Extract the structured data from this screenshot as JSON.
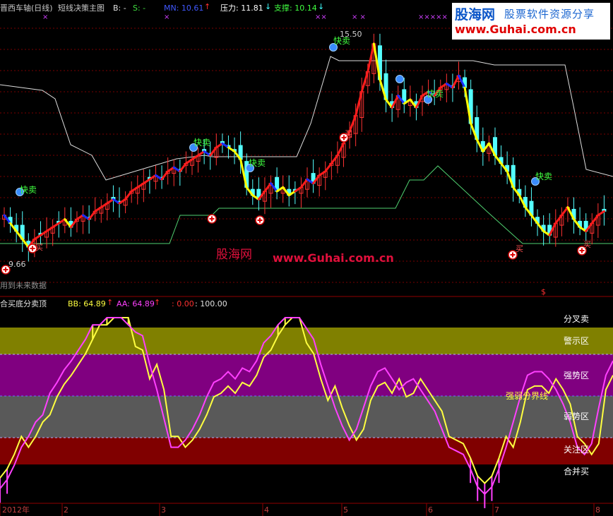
{
  "upper_panel": {
    "stock_name": "晋西车轴(日线)",
    "indicator_name": "短线决策主图",
    "b_label": "B: -",
    "s_label": "S: -",
    "mn_label": "MN: 10.61",
    "mn_arrow": "↑",
    "pressure_label": "压力: 11.81",
    "pressure_arrow": "↓",
    "support_label": "支撑: 10.14",
    "support_arrow": "↓",
    "high_price_label": "15.50",
    "low_price_label": "9.66",
    "future_data_note": "用到未来数据",
    "dollar_mark": "$",
    "fast_sell_label": "快卖",
    "buy_label": "买",
    "cross_marks": [
      "×",
      "×",
      "××",
      "× ×",
      "×××××",
      "×"
    ]
  },
  "lower_panel": {
    "indicator_name": "合买底分卖顶",
    "bb_label": "BB: 64.89",
    "bb_arrow": "↑",
    "aa_label": "AA: 64.89",
    "aa_arrow": "↑",
    "range_label": ": 0.00",
    "range_max_label": ": 100.00",
    "zones": [
      "分叉卖",
      "警示区",
      "强势区",
      "强弱分界线",
      "弱势区",
      "关注区",
      "合并买"
    ]
  },
  "time_axis": {
    "labels": [
      "2012年",
      "2",
      "3",
      "4",
      "5",
      "6",
      "7",
      "8"
    ]
  },
  "watermark": {
    "logo_cn": "股海网",
    "logo_sub": "股票软件资源分享",
    "logo_url": "www.Guhai.com.cn",
    "center_cn": "股海网",
    "center_url": "www.Guhai.com.cn"
  },
  "colors": {
    "background": "#000000",
    "candle_up": "#ff3232",
    "candle_down": "#54ffff",
    "trend_red": "#ff1c1c",
    "trend_yellow": "#ffff00",
    "trend_blue": "#1a2cff",
    "resistance_line": "#dcdcdc",
    "support_line": "#50d070",
    "grid": "#7a0000",
    "zone_olive": "#808000",
    "zone_purple": "#800080",
    "zone_gray": "#595959",
    "zone_red": "#800000",
    "line_magenta": "#ff40ff",
    "line_yellow": "#ffff40"
  },
  "chart_data": {
    "type": "candlestick",
    "price_high": 15.5,
    "price_low": 9.66,
    "mn": 10.61,
    "pressure": 11.81,
    "support": 10.14,
    "bb": 64.89,
    "aa": 64.89,
    "oscillator_range": [
      0.0,
      100.0
    ],
    "months": [
      "2012年",
      "2",
      "3",
      "4",
      "5",
      "6",
      "7",
      "8"
    ],
    "price_series": [
      10.9,
      10.7,
      10.5,
      10.3,
      10.1,
      10.3,
      10.4,
      10.5,
      10.6,
      10.7,
      10.8,
      10.6,
      10.8,
      10.9,
      10.8,
      11.0,
      11.1,
      11.2,
      11.3,
      11.2,
      11.3,
      11.5,
      11.6,
      11.7,
      11.8,
      11.9,
      11.8,
      12.0,
      12.1,
      12.0,
      12.2,
      12.3,
      12.4,
      12.5,
      12.4,
      12.6,
      12.7,
      12.6,
      12.5,
      12.3,
      11.6,
      11.4,
      11.3,
      11.5,
      11.7,
      11.5,
      11.6,
      11.4,
      11.5,
      11.6,
      11.8,
      11.7,
      11.9,
      12.0,
      12.2,
      12.4,
      12.7,
      13.0,
      13.4,
      14.0,
      14.5,
      15.2,
      14.3,
      13.8,
      13.6,
      13.9,
      13.7,
      13.8,
      13.6,
      13.9,
      14.0,
      13.9,
      14.1,
      14.2,
      14.1,
      14.4,
      14.1,
      13.2,
      12.8,
      12.5,
      12.7,
      12.4,
      12.2,
      12.0,
      11.6,
      11.4,
      11.1,
      10.9,
      10.7,
      10.5,
      10.4,
      10.7,
      10.9,
      11.1,
      10.8,
      10.6,
      10.5,
      10.7,
      10.9,
      11.0
    ],
    "oscillator_series": [
      5,
      10,
      18,
      28,
      34,
      42,
      46,
      58,
      64,
      71,
      76,
      82,
      88,
      96,
      96,
      100,
      100,
      100,
      96,
      92,
      90,
      74,
      60,
      44,
      28,
      28,
      32,
      38,
      46,
      56,
      64,
      66,
      70,
      66,
      72,
      70,
      76,
      86,
      90,
      96,
      100,
      100,
      100,
      94,
      88,
      74,
      62,
      50,
      40,
      32,
      38,
      50,
      62,
      70,
      72,
      66,
      60,
      64,
      66,
      60,
      54,
      48,
      38,
      28,
      26,
      24,
      16,
      6,
      2,
      6,
      16,
      28,
      42,
      56,
      68,
      70,
      70,
      66,
      60,
      52,
      42,
      28,
      24,
      30,
      50,
      68,
      76
    ],
    "trend_series": [
      12,
      14,
      15,
      16,
      17,
      19,
      19,
      20,
      21,
      21,
      22,
      22,
      23,
      24,
      24,
      26,
      27,
      28,
      30,
      31,
      32,
      33,
      34,
      36,
      37,
      37,
      38,
      38,
      39,
      39,
      40,
      40,
      41,
      41,
      41,
      42,
      42,
      42,
      41,
      40,
      38,
      36,
      35,
      34,
      34,
      34,
      35,
      35,
      36,
      37,
      38,
      40,
      42,
      44,
      46,
      49,
      53,
      58,
      63,
      68,
      72,
      75,
      76,
      76,
      76,
      75,
      75,
      75,
      75,
      75,
      76,
      76,
      77,
      77,
      76,
      74,
      70,
      65,
      60,
      56,
      53,
      50,
      47,
      44,
      41,
      38,
      35,
      33,
      32,
      32,
      32,
      33,
      34,
      34,
      33,
      32,
      31,
      31,
      32,
      33,
      34
    ]
  }
}
